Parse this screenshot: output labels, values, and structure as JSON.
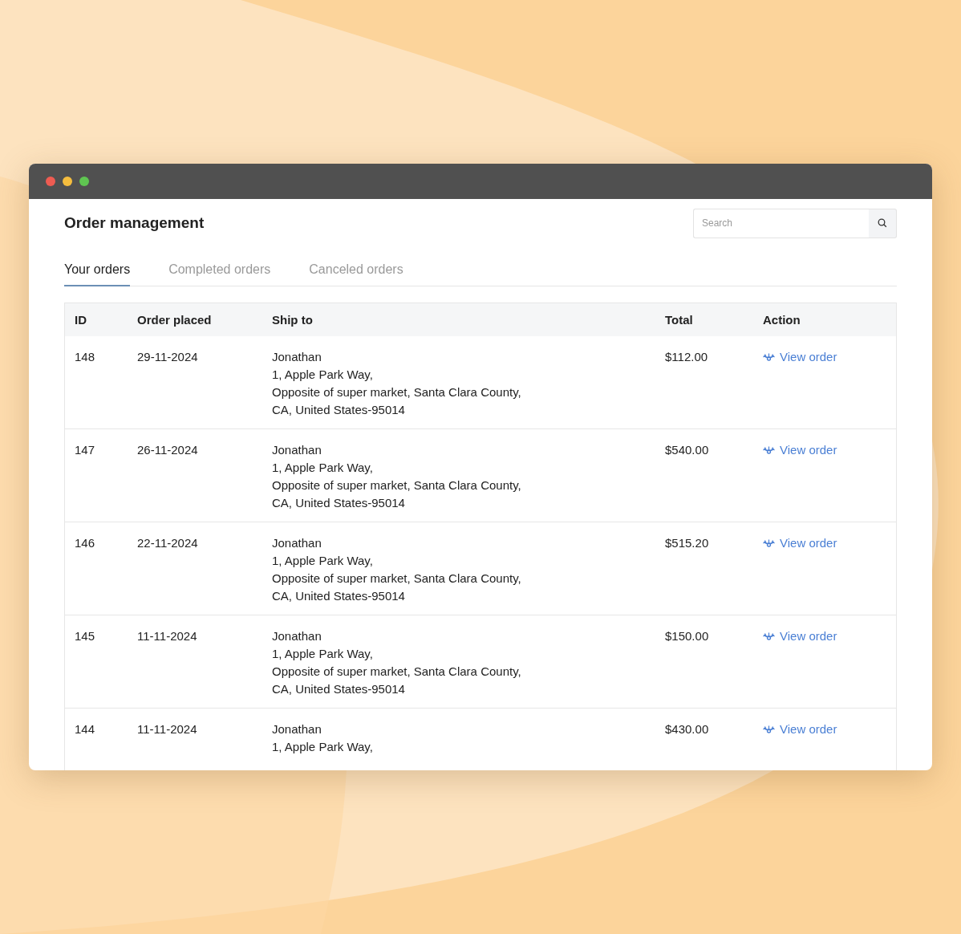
{
  "page": {
    "title": "Order management"
  },
  "search": {
    "placeholder": "Search"
  },
  "tabs": [
    {
      "label": "Your orders",
      "selected": true
    },
    {
      "label": "Completed orders",
      "selected": false
    },
    {
      "label": "Canceled orders",
      "selected": false
    }
  ],
  "table": {
    "columns": [
      "ID",
      "Order placed",
      "Ship to",
      "Total",
      "Action"
    ],
    "rows": [
      {
        "id": "148",
        "order_placed": "29-11-2024",
        "ship_to": [
          "Jonathan",
          "1, Apple Park Way,",
          "Opposite of super market, Santa Clara County,",
          "CA, United States-95014"
        ],
        "total": "$112.00",
        "action": "View order"
      },
      {
        "id": "147",
        "order_placed": "26-11-2024",
        "ship_to": [
          "Jonathan",
          "1, Apple Park Way,",
          "Opposite of super market, Santa Clara County,",
          "CA, United States-95014"
        ],
        "total": "$540.00",
        "action": "View order"
      },
      {
        "id": "146",
        "order_placed": "22-11-2024",
        "ship_to": [
          "Jonathan",
          "1, Apple Park Way,",
          "Opposite of super market, Santa Clara County,",
          "CA, United States-95014"
        ],
        "total": "$515.20",
        "action": "View order"
      },
      {
        "id": "145",
        "order_placed": "11-11-2024",
        "ship_to": [
          "Jonathan",
          "1, Apple Park Way,",
          "Opposite of super market, Santa Clara County,",
          "CA, United States-95014"
        ],
        "total": "$150.00",
        "action": "View order"
      },
      {
        "id": "144",
        "order_placed": "11-11-2024",
        "ship_to": [
          "Jonathan",
          "1, Apple Park Way,"
        ],
        "total": "$430.00",
        "action": "View order"
      }
    ]
  }
}
